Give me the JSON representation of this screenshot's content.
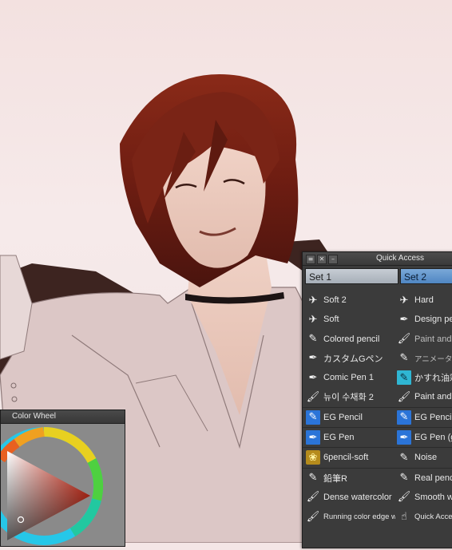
{
  "quick_access": {
    "title": "Quick Access",
    "sets": [
      "Set 1",
      "Set 2"
    ],
    "rows": [
      {
        "left": {
          "label": "Soft 2",
          "icon": "airbrush-icon"
        },
        "right": {
          "label": "Hard",
          "icon": "airbrush-icon"
        }
      },
      {
        "left": {
          "label": "Soft",
          "icon": "airbrush-icon"
        },
        "right": {
          "label": "Design pe",
          "icon": "pen-icon"
        }
      },
      {
        "left": {
          "label": "Colored pencil",
          "icon": "pencil-icon"
        },
        "right": {
          "label": "Paint and",
          "icon": "brush-icon"
        }
      },
      {
        "left": {
          "label": "カスタムGペン",
          "icon": "pen-icon"
        },
        "right": {
          "label": "アニメーター",
          "icon": "pencil-icon"
        }
      },
      {
        "left": {
          "label": "Comic Pen 1",
          "icon": "pen-icon"
        },
        "right": {
          "label": "かすれ油彩",
          "icon": "oil-brush-icon"
        }
      },
      {
        "left": {
          "label": "뉴이 수채화 2",
          "icon": "brush-icon"
        },
        "right": {
          "label": "Paint and",
          "icon": "brush-icon"
        }
      },
      {
        "left": {
          "label": "EG Pencil",
          "icon": "pencil-icon"
        },
        "right": {
          "label": "EG Pencil",
          "icon": "pencil-icon"
        }
      },
      {
        "left": {
          "label": "EG Pen",
          "icon": "pen-icon"
        },
        "right": {
          "label": "EG Pen (g",
          "icon": "pen-icon"
        }
      },
      {
        "left": {
          "label": "6pencil-soft",
          "icon": "texture-icon"
        },
        "right": {
          "label": "Noise",
          "icon": "pencil-icon"
        }
      },
      {
        "left": {
          "label": "鉛筆R",
          "icon": "pencil-icon"
        },
        "right": {
          "label": "Real penc",
          "icon": "pencil-icon"
        }
      },
      {
        "left": {
          "label": "Dense watercolor",
          "icon": "brush-icon"
        },
        "right": {
          "label": "Smooth wa",
          "icon": "brush-icon"
        }
      },
      {
        "left": {
          "label": "Running color edge wa",
          "icon": "brush-icon"
        },
        "right": {
          "label": "Quick Acces",
          "icon": "quick-access-icon"
        }
      }
    ]
  },
  "color_wheel": {
    "title": "Color Wheel",
    "current_color": "#c9c7c7"
  },
  "colors": {
    "panel_bg": "#3b3b3b",
    "set_active": "#4f86c2",
    "set_inactive": "#b0b7c0",
    "highlight_icon": "#2b74d8"
  }
}
